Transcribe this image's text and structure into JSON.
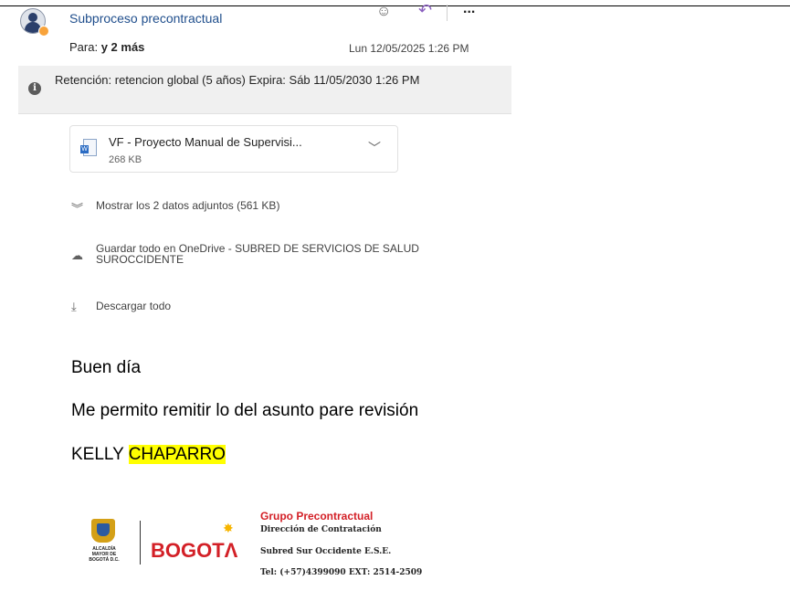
{
  "header": {
    "subject": "Subproceso precontractual",
    "to_label": "Para:",
    "to_value": "y 2 más",
    "date": "Lun 12/05/2025 1:26 PM"
  },
  "toolbar": {
    "emoji_icon": "smiley-icon",
    "reply_icon": "reply-icon",
    "more_icon": "ellipsis-icon",
    "more_label": "..."
  },
  "retention": {
    "text": "Retención: retencion global (5 años) Expira: Sáb 11/05/2030 1:26 PM"
  },
  "attachment": {
    "name": "VF - Proyecto Manual de Supervisi...",
    "size": "268 KB"
  },
  "actions": {
    "show_all": "Mostrar los 2 datos adjuntos (561 KB)",
    "save_onedrive": "Guardar todo en OneDrive - SUBRED DE SERVICIOS DE SALUD SUROCCIDENTE",
    "download_all": "Descargar todo"
  },
  "message": {
    "greeting": "Buen día",
    "line": "Me permito remitir lo del asunto pare revisión",
    "sign_first": "KELLY",
    "sign_last": "CHAPARRO"
  },
  "signature": {
    "alcaldia": "ALCALDÍA MAYOR DE BOGOTÁ D.C.",
    "logo": "BOGOTΛ",
    "group": "Grupo Precontractual",
    "line1": "Dirección de Contratación",
    "line2": "Subred Sur Occidente E.S.E.",
    "line3": "Tel: (+57)4399090  EXT: 2514-2509"
  },
  "colors": {
    "accent": "#1f4e8c",
    "highlight": "#ffff00",
    "brand_red": "#d32027"
  }
}
